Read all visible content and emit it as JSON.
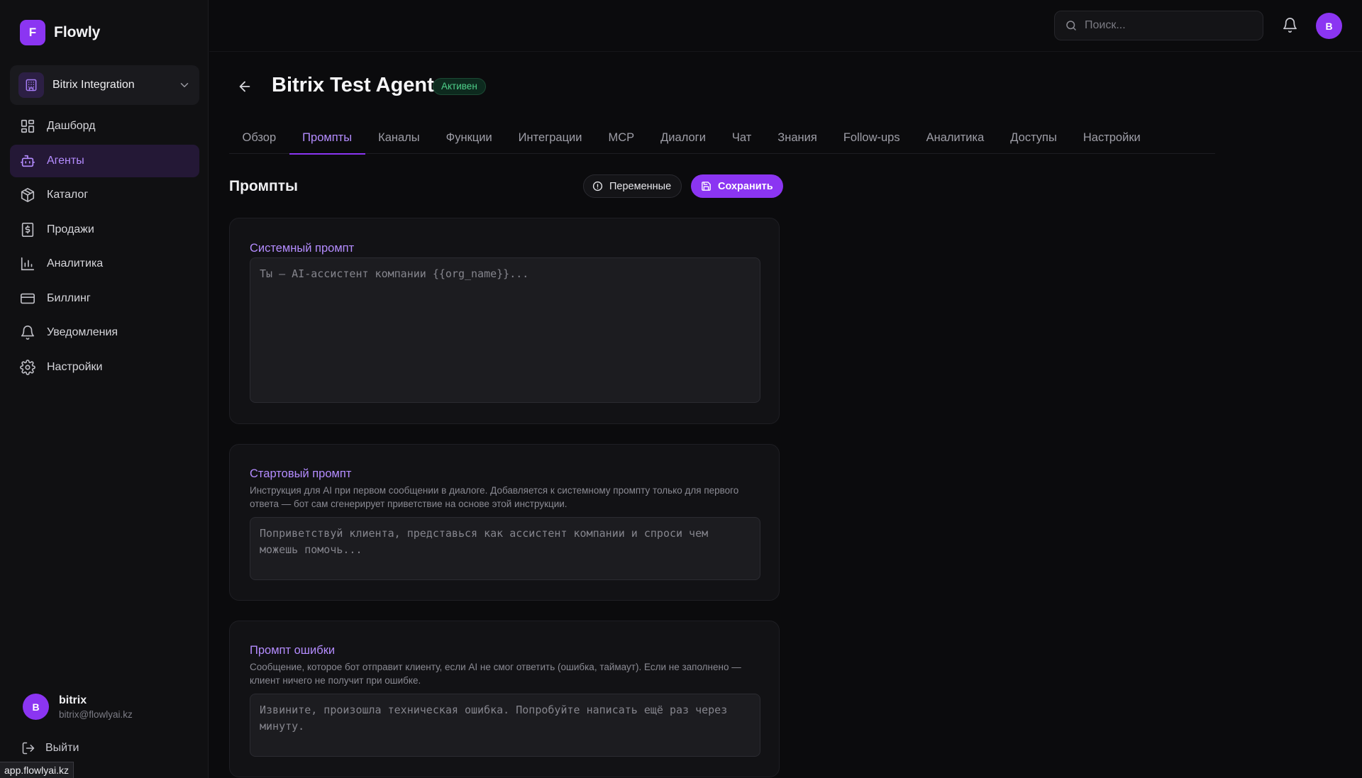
{
  "brand": {
    "logo_letter": "F",
    "name": "Flowly",
    "accent": "#8b35f2"
  },
  "workspace": {
    "name": "Bitrix Integration",
    "icon": "building-icon"
  },
  "nav": {
    "items": [
      {
        "label": "Дашборд",
        "icon": "dashboard-icon",
        "active": false
      },
      {
        "label": "Агенты",
        "icon": "bot-icon",
        "active": true
      },
      {
        "label": "Каталог",
        "icon": "package-icon",
        "active": false
      },
      {
        "label": "Продажи",
        "icon": "receipt-dollar-icon",
        "active": false
      },
      {
        "label": "Аналитика",
        "icon": "bar-chart-icon",
        "active": false
      },
      {
        "label": "Биллинг",
        "icon": "credit-card-icon",
        "active": false
      },
      {
        "label": "Уведомления",
        "icon": "bell-icon",
        "active": false
      },
      {
        "label": "Настройки",
        "icon": "gear-icon",
        "active": false
      }
    ]
  },
  "user": {
    "avatar_letter": "B",
    "name": "bitrix",
    "email": "bitrix@flowlyai.kz",
    "logout_label": "Выйти"
  },
  "status_bar": {
    "url": "app.flowlyai.kz"
  },
  "topbar": {
    "search_placeholder": "Поиск...",
    "avatar_letter": "B"
  },
  "header": {
    "title": "Bitrix Test Agent",
    "status": "Активен",
    "status_color": "#4fd08a"
  },
  "tabs": [
    {
      "label": "Обзор",
      "active": false
    },
    {
      "label": "Промпты",
      "active": true
    },
    {
      "label": "Каналы",
      "active": false
    },
    {
      "label": "Функции",
      "active": false
    },
    {
      "label": "Интеграции",
      "active": false
    },
    {
      "label": "MCP",
      "active": false
    },
    {
      "label": "Диалоги",
      "active": false
    },
    {
      "label": "Чат",
      "active": false
    },
    {
      "label": "Знания",
      "active": false
    },
    {
      "label": "Follow-ups",
      "active": false
    },
    {
      "label": "Аналитика",
      "active": false
    },
    {
      "label": "Доступы",
      "active": false
    },
    {
      "label": "Настройки",
      "active": false
    }
  ],
  "section": {
    "title": "Промпты",
    "variables_label": "Переменные",
    "save_label": "Сохранить"
  },
  "prompts": {
    "system": {
      "label": "Системный промпт",
      "value": "",
      "placeholder": "Ты — AI-ассистент компании {{org_name}}..."
    },
    "start": {
      "label": "Стартовый промпт",
      "description": "Инструкция для AI при первом сообщении в диалоге. Добавляется к системному промпту только для первого ответа — бот сам сгенерирует приветствие на основе этой инструкции.",
      "value": "",
      "placeholder": "Поприветствуй клиента, представься как ассистент компании и спроси чем можешь помочь..."
    },
    "error": {
      "label": "Промпт ошибки",
      "description": "Сообщение, которое бот отправит клиенту, если AI не смог ответить (ошибка, таймаут). Если не заполнено — клиент ничего не получит при ошибке.",
      "value": "",
      "placeholder": "Извините, произошла техническая ошибка. Попробуйте написать ещё раз через минуту."
    }
  }
}
